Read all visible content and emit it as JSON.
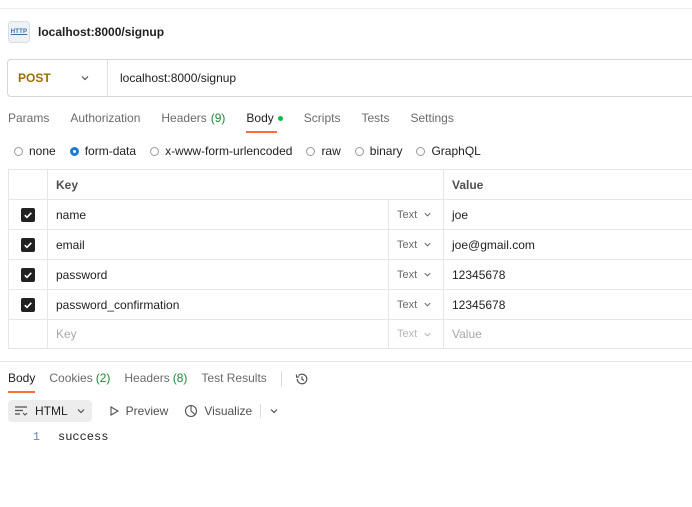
{
  "request": {
    "title": "localhost:8000/signup",
    "icon_text": "HTTP",
    "method": "POST",
    "url": "localhost:8000/signup"
  },
  "tabs": [
    {
      "label": "Params"
    },
    {
      "label": "Authorization"
    },
    {
      "label": "Headers",
      "count": "(9)"
    },
    {
      "label": "Body",
      "active": true
    },
    {
      "label": "Scripts"
    },
    {
      "label": "Tests"
    },
    {
      "label": "Settings"
    }
  ],
  "body_types": [
    "none",
    "form-data",
    "x-www-form-urlencoded",
    "raw",
    "binary",
    "GraphQL"
  ],
  "body_type_selected": "form-data",
  "table": {
    "key_header": "Key",
    "value_header": "Value",
    "rows": [
      {
        "key": "name",
        "type": "Text",
        "value": "joe"
      },
      {
        "key": "email",
        "type": "Text",
        "value": "joe@gmail.com"
      },
      {
        "key": "password",
        "type": "Text",
        "value": "12345678"
      },
      {
        "key": "password_confirmation",
        "type": "Text",
        "value": "12345678"
      }
    ],
    "placeholder": {
      "key": "Key",
      "type": "Text",
      "value": "Value"
    }
  },
  "response": {
    "tabs": [
      {
        "label": "Body",
        "active": true
      },
      {
        "label": "Cookies",
        "count": "(2)"
      },
      {
        "label": "Headers",
        "count": "(8)"
      },
      {
        "label": "Test Results"
      }
    ],
    "format": "HTML",
    "preview": "Preview",
    "visualize": "Visualize",
    "line_number": "1",
    "content": "success"
  },
  "colors": {
    "accent": "#ff6c37",
    "method": "#9a6f00",
    "count_green": "#1a8a3a",
    "radio_blue": "#1f78d1"
  }
}
